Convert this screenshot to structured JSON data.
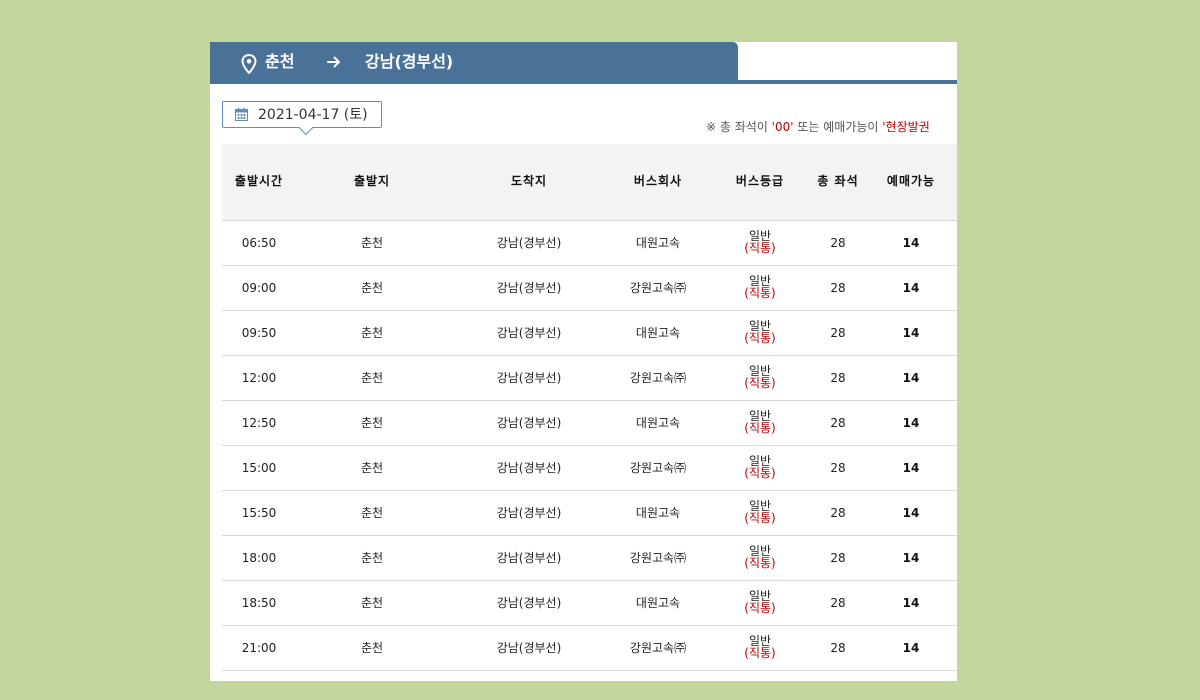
{
  "route": {
    "from": "춘천",
    "arrow": "→",
    "to": "강남(경부선)"
  },
  "date": {
    "value": "2021-04-17 (토)"
  },
  "notice": {
    "prefix": "※ 총 좌석이 ",
    "zero": "'00'",
    "middle": " 또는 예매가능이 ",
    "onsite": "'현장발권"
  },
  "table": {
    "headers": {
      "time": "출발시간",
      "from": "출발지",
      "to": "도착지",
      "company": "버스회사",
      "grade": "버스등급",
      "seats": "총 좌석",
      "avail": "예매가능"
    },
    "rows": [
      {
        "time": "06:50",
        "from": "춘천",
        "to": "강남(경부선)",
        "company": "대원고속",
        "grade": "일반",
        "grade_sub": "(직통)",
        "seats": "28",
        "avail": "14"
      },
      {
        "time": "09:00",
        "from": "춘천",
        "to": "강남(경부선)",
        "company": "강원고속㈜",
        "grade": "일반",
        "grade_sub": "(직통)",
        "seats": "28",
        "avail": "14"
      },
      {
        "time": "09:50",
        "from": "춘천",
        "to": "강남(경부선)",
        "company": "대원고속",
        "grade": "일반",
        "grade_sub": "(직통)",
        "seats": "28",
        "avail": "14"
      },
      {
        "time": "12:00",
        "from": "춘천",
        "to": "강남(경부선)",
        "company": "강원고속㈜",
        "grade": "일반",
        "grade_sub": "(직통)",
        "seats": "28",
        "avail": "14"
      },
      {
        "time": "12:50",
        "from": "춘천",
        "to": "강남(경부선)",
        "company": "대원고속",
        "grade": "일반",
        "grade_sub": "(직통)",
        "seats": "28",
        "avail": "14"
      },
      {
        "time": "15:00",
        "from": "춘천",
        "to": "강남(경부선)",
        "company": "강원고속㈜",
        "grade": "일반",
        "grade_sub": "(직통)",
        "seats": "28",
        "avail": "14"
      },
      {
        "time": "15:50",
        "from": "춘천",
        "to": "강남(경부선)",
        "company": "대원고속",
        "grade": "일반",
        "grade_sub": "(직통)",
        "seats": "28",
        "avail": "14"
      },
      {
        "time": "18:00",
        "from": "춘천",
        "to": "강남(경부선)",
        "company": "강원고속㈜",
        "grade": "일반",
        "grade_sub": "(직통)",
        "seats": "28",
        "avail": "14"
      },
      {
        "time": "18:50",
        "from": "춘천",
        "to": "강남(경부선)",
        "company": "대원고속",
        "grade": "일반",
        "grade_sub": "(직통)",
        "seats": "28",
        "avail": "14"
      },
      {
        "time": "21:00",
        "from": "춘천",
        "to": "강남(경부선)",
        "company": "강원고속㈜",
        "grade": "일반",
        "grade_sub": "(직통)",
        "seats": "28",
        "avail": "14"
      }
    ]
  },
  "colors": {
    "page_background": "#c3d69b",
    "route_bar": "#4a7298",
    "accent_red": "#c00000",
    "date_border": "#5f8fb8"
  },
  "icons": {
    "pin": "map-pin-icon",
    "arrow": "arrow-right-icon",
    "calendar": "calendar-icon"
  }
}
